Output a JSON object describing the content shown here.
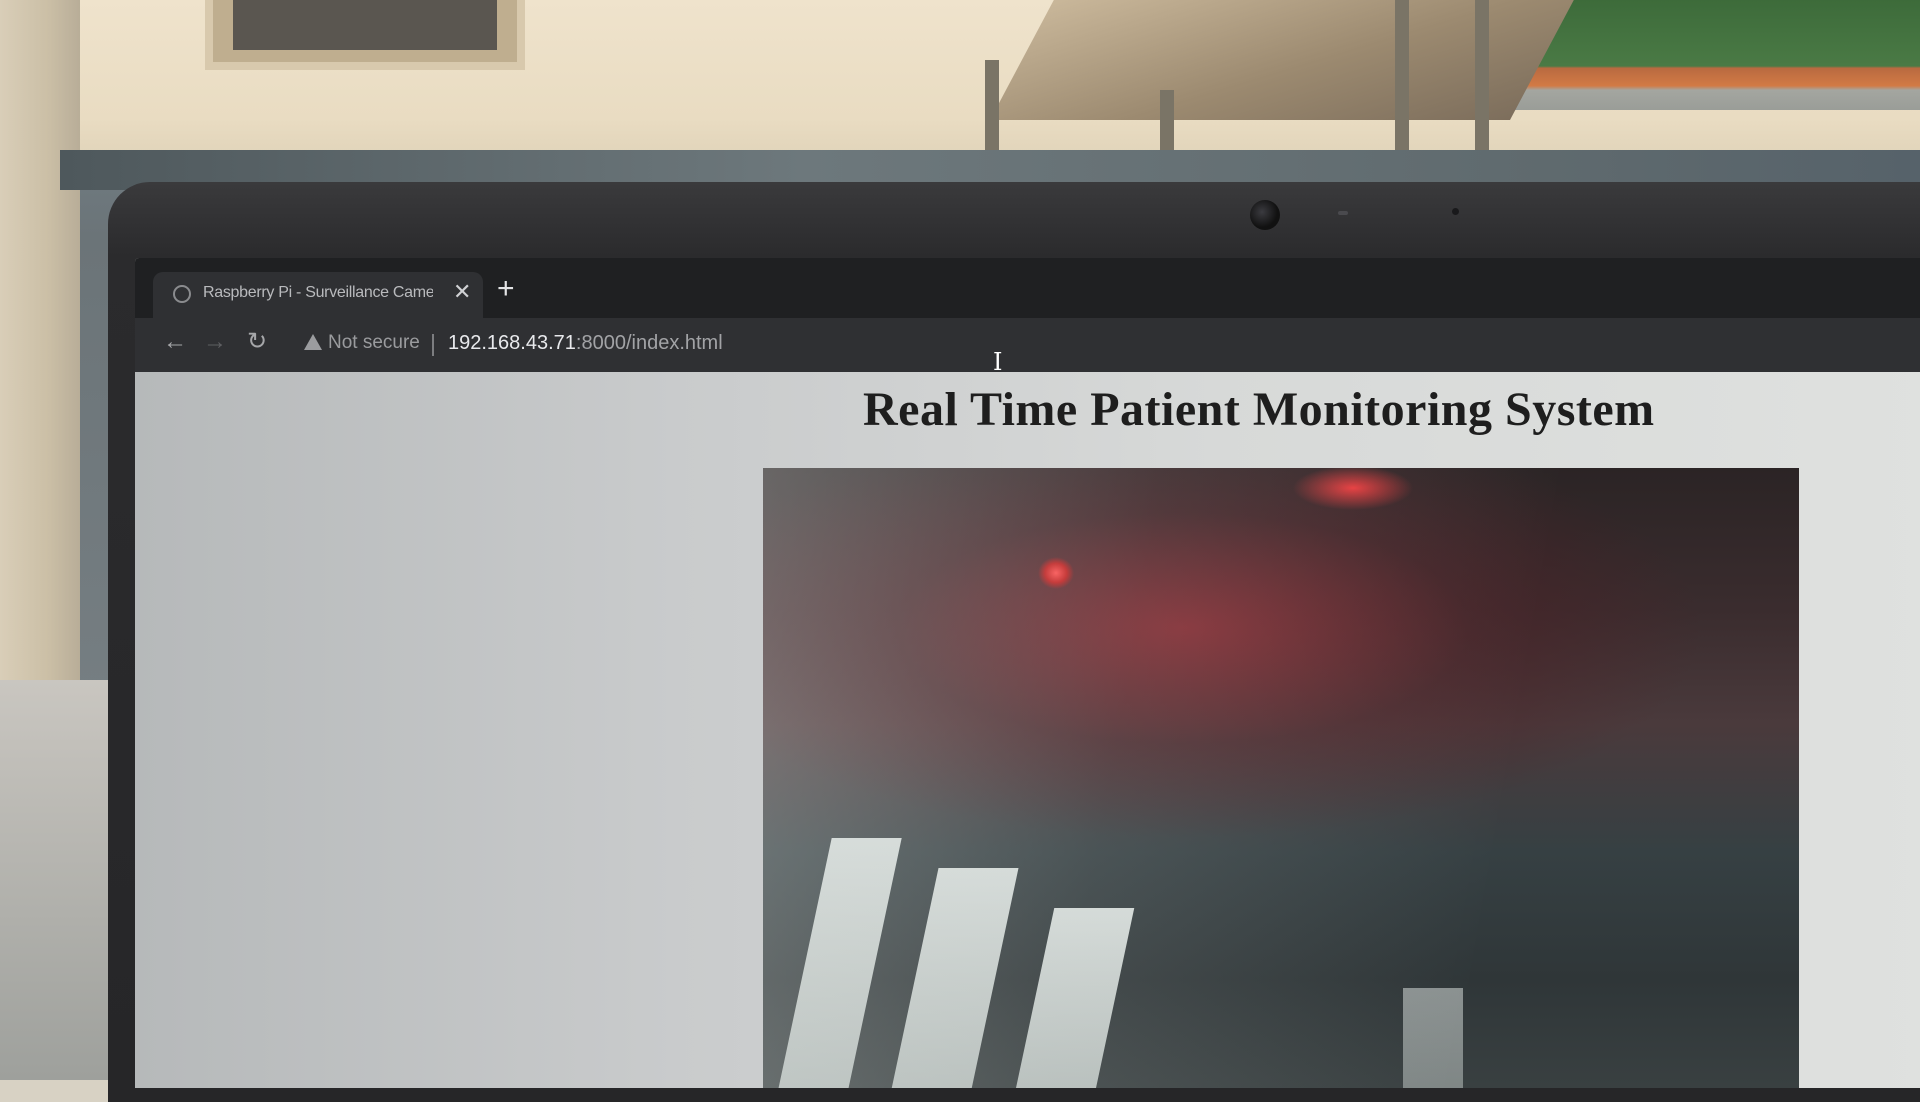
{
  "browser": {
    "tab": {
      "title": "Raspberry Pi - Surveillance Came",
      "close_glyph": "✕",
      "favicon_icon": "globe-icon"
    },
    "new_tab_glyph": "+",
    "nav": {
      "back_glyph": "←",
      "forward_glyph": "→",
      "reload_glyph": "↻"
    },
    "address": {
      "security_label": "Not secure",
      "host": "192.168.43.71",
      "path": ":8000/index.html"
    },
    "text_cursor_glyph": "I"
  },
  "page": {
    "title": "Real Time Patient Monitoring System",
    "stream_icon": "camera-feed"
  },
  "colors": {
    "browser_tabbar": "#1f2022",
    "browser_toolbar": "#2f3033",
    "page_background": "#d7d9d8",
    "title_text": "#1e1e1e",
    "stream_led": "#ff4a4a"
  }
}
